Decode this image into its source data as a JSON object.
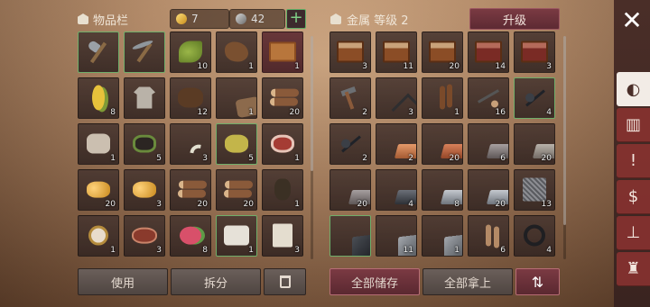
{
  "inventory": {
    "title": "物品栏",
    "gold_count": "7",
    "ore_count": "42",
    "add_symbol": "+",
    "slots": [
      {
        "icon": "axe",
        "qty": "",
        "hl": true
      },
      {
        "icon": "pick",
        "qty": "",
        "hl": true
      },
      {
        "icon": "leaf",
        "qty": "10"
      },
      {
        "icon": "hide",
        "qty": "1"
      },
      {
        "icon": "bundle",
        "qty": "1",
        "red": true
      },
      {
        "icon": "corn",
        "qty": "8"
      },
      {
        "icon": "shirt",
        "qty": ""
      },
      {
        "icon": "fur",
        "qty": "12"
      },
      {
        "icon": "leather",
        "qty": "1"
      },
      {
        "icon": "logs",
        "qty": "20"
      },
      {
        "icon": "cloth",
        "qty": "1"
      },
      {
        "icon": "coal",
        "qty": "5"
      },
      {
        "icon": "fang",
        "qty": "3"
      },
      {
        "icon": "sulfur",
        "qty": "5",
        "hl": true
      },
      {
        "icon": "meat",
        "qty": "1"
      },
      {
        "icon": "nugget",
        "qty": "20"
      },
      {
        "icon": "nugget",
        "qty": "3"
      },
      {
        "icon": "logs",
        "qty": "20"
      },
      {
        "icon": "logs",
        "qty": "20"
      },
      {
        "icon": "sack",
        "qty": "1"
      },
      {
        "icon": "watch",
        "qty": "1"
      },
      {
        "icon": "steak",
        "qty": "3"
      },
      {
        "icon": "fruit",
        "qty": "8"
      },
      {
        "icon": "roll",
        "qty": "1",
        "hl": true
      },
      {
        "icon": "paper",
        "qty": "3"
      }
    ],
    "buttons": {
      "use": "使用",
      "split": "拆分"
    }
  },
  "storage": {
    "title": "金属 等级 2",
    "upgrade_label": "升级",
    "slots": [
      {
        "icon": "box",
        "qty": "3"
      },
      {
        "icon": "box",
        "qty": "11"
      },
      {
        "icon": "box",
        "qty": "20"
      },
      {
        "icon": "box redbox",
        "qty": "14"
      },
      {
        "icon": "box redbox",
        "qty": "3"
      },
      {
        "icon": "hammers",
        "qty": "2"
      },
      {
        "icon": "tongs",
        "qty": "3"
      },
      {
        "icon": "nail",
        "qty": "1"
      },
      {
        "icon": "rivet",
        "qty": "16"
      },
      {
        "icon": "spikes",
        "qty": "4",
        "hl": true
      },
      {
        "icon": "spikes",
        "qty": "2"
      },
      {
        "icon": "ingot copper",
        "qty": "2"
      },
      {
        "icon": "ingot copper2",
        "qty": "20"
      },
      {
        "icon": "ingot iron",
        "qty": "6"
      },
      {
        "icon": "ingot iron2",
        "qty": "20"
      },
      {
        "icon": "ingot iron",
        "qty": "20"
      },
      {
        "icon": "ingot darksteel",
        "qty": "4"
      },
      {
        "icon": "ingot steel",
        "qty": "8"
      },
      {
        "icon": "ingot steel",
        "qty": "20"
      },
      {
        "icon": "mesh",
        "qty": "13"
      },
      {
        "icon": "plate",
        "qty": "",
        "hl": true
      },
      {
        "icon": "plate2",
        "qty": "11"
      },
      {
        "icon": "plate2",
        "qty": "1"
      },
      {
        "icon": "rod",
        "qty": "6"
      },
      {
        "icon": "coil",
        "qty": "4"
      }
    ],
    "buttons": {
      "store_all": "全部储存",
      "take_all": "全部拿上"
    }
  },
  "sidebar": {
    "close_symbol": "✕",
    "tabs": [
      {
        "name": "backpack-tab",
        "glyph": "◐",
        "active": true
      },
      {
        "name": "workbench-tab",
        "glyph": "▥",
        "active": false
      },
      {
        "name": "journal-tab",
        "glyph": "!",
        "active": false
      },
      {
        "name": "money-tab",
        "glyph": "$",
        "active": false
      },
      {
        "name": "anvil-tab",
        "glyph": "⊥",
        "active": false
      },
      {
        "name": "bag-tab",
        "glyph": "♜",
        "active": false
      }
    ]
  },
  "colors": {
    "highlight": "#6fae6a",
    "accent_red": "#7b3a43"
  }
}
